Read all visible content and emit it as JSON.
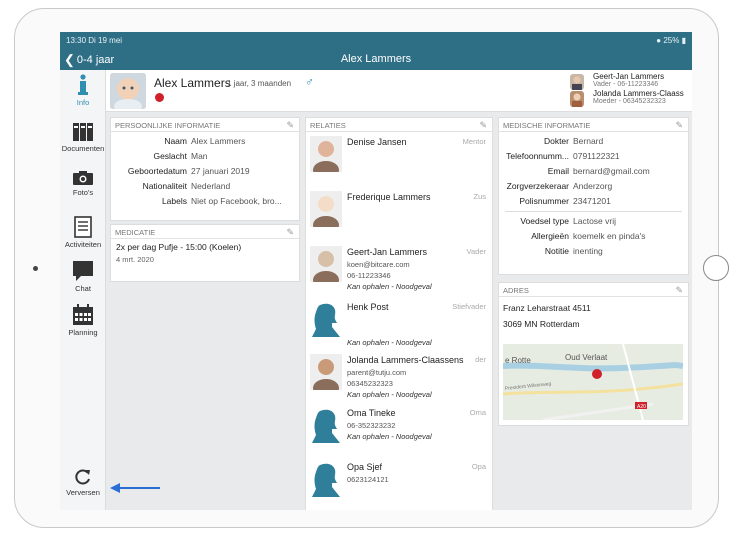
{
  "status": {
    "time": "13:30",
    "date": "Di 19 mei",
    "battery": "25%"
  },
  "nav": {
    "back": "0-4 jaar",
    "title": "Alex Lammers"
  },
  "sidebar": {
    "items": [
      {
        "label": "Info",
        "icon": "info-icon"
      },
      {
        "label": "Documenten",
        "icon": "documents-icon"
      },
      {
        "label": "Foto's",
        "icon": "camera-icon"
      },
      {
        "label": "Activiteiten",
        "icon": "activities-icon"
      },
      {
        "label": "Chat",
        "icon": "chat-icon"
      },
      {
        "label": "Planning",
        "icon": "calendar-icon"
      }
    ],
    "refresh": "Verversen"
  },
  "child": {
    "name": "Alex Lammers",
    "age": "1 jaar, 3 maanden",
    "gender_icon": "male-icon",
    "status_color": "#d0202a"
  },
  "parents": [
    {
      "name": "Geert-Jan Lammers",
      "sub": "Vader - 06-11223346"
    },
    {
      "name": "Jolanda Lammers-Claass",
      "sub": "Moeder - 06345232323"
    }
  ],
  "personal": {
    "title": "PERSOONLIJKE INFORMATIE",
    "rows": [
      {
        "k": "Naam",
        "v": "Alex Lammers"
      },
      {
        "k": "Geslacht",
        "v": "Man"
      },
      {
        "k": "Geboortedatum",
        "v": "27 januari 2019"
      },
      {
        "k": "Nationaliteit",
        "v": "Nederland"
      },
      {
        "k": "Labels",
        "v": "Niet op Facebook, bro..."
      }
    ]
  },
  "medication": {
    "title": "MEDICATIE",
    "item": "2x per dag Pufje - 15:00 (Koelen)",
    "date": "4 mrt. 2020"
  },
  "relations": {
    "title": "RELATIES",
    "items": [
      {
        "name": "Denise Jansen",
        "role": "Mentor",
        "lines": []
      },
      {
        "name": "Frederique Lammers",
        "role": "Zus",
        "lines": []
      },
      {
        "name": "Geert-Jan Lammers",
        "role": "Vader",
        "lines": [
          "koen@bitcare.com",
          "06-11223346"
        ],
        "note": "Kan ophalen - Noodgeval"
      },
      {
        "name": "Henk Post",
        "role": "Stiefvader",
        "lines": [],
        "note": "Kan ophalen - Noodgeval"
      },
      {
        "name": "Jolanda Lammers-Claassens",
        "role": "der",
        "lines": [
          "parent@tutju.com",
          "06345232323"
        ],
        "note": "Kan ophalen - Noodgeval"
      },
      {
        "name": "Oma Tineke",
        "role": "Oma",
        "lines": [
          "06-352323232"
        ],
        "note": "Kan ophalen - Noodgeval"
      },
      {
        "name": "Opa Sjef",
        "role": "Opa",
        "lines": [
          "0623124121"
        ]
      }
    ]
  },
  "medical": {
    "title": "MEDISCHE INFORMATIE",
    "rows": [
      {
        "k": "Dokter",
        "v": "Bernard"
      },
      {
        "k": "Telefoonnumm...",
        "v": "0791122321"
      },
      {
        "k": "Email",
        "v": "bernard@gmail.com"
      },
      {
        "k": "Zorgverzekeraar",
        "v": "Anderzorg"
      },
      {
        "k": "Polisnummer",
        "v": "23471201"
      }
    ],
    "rows2": [
      {
        "k": "Voedsel type",
        "v": "Lactose vrij"
      },
      {
        "k": "Allergieën",
        "v": "koemelk en pinda's"
      },
      {
        "k": "Notitie",
        "v": "inenting"
      }
    ]
  },
  "address": {
    "title": "ADRES",
    "street": "Franz Leharstraat 4511",
    "city": "3069 MN Rotterdam",
    "map_labels": [
      "Oud Verlaat",
      "e Rotte",
      "President Wilsonweg",
      "A20"
    ]
  }
}
